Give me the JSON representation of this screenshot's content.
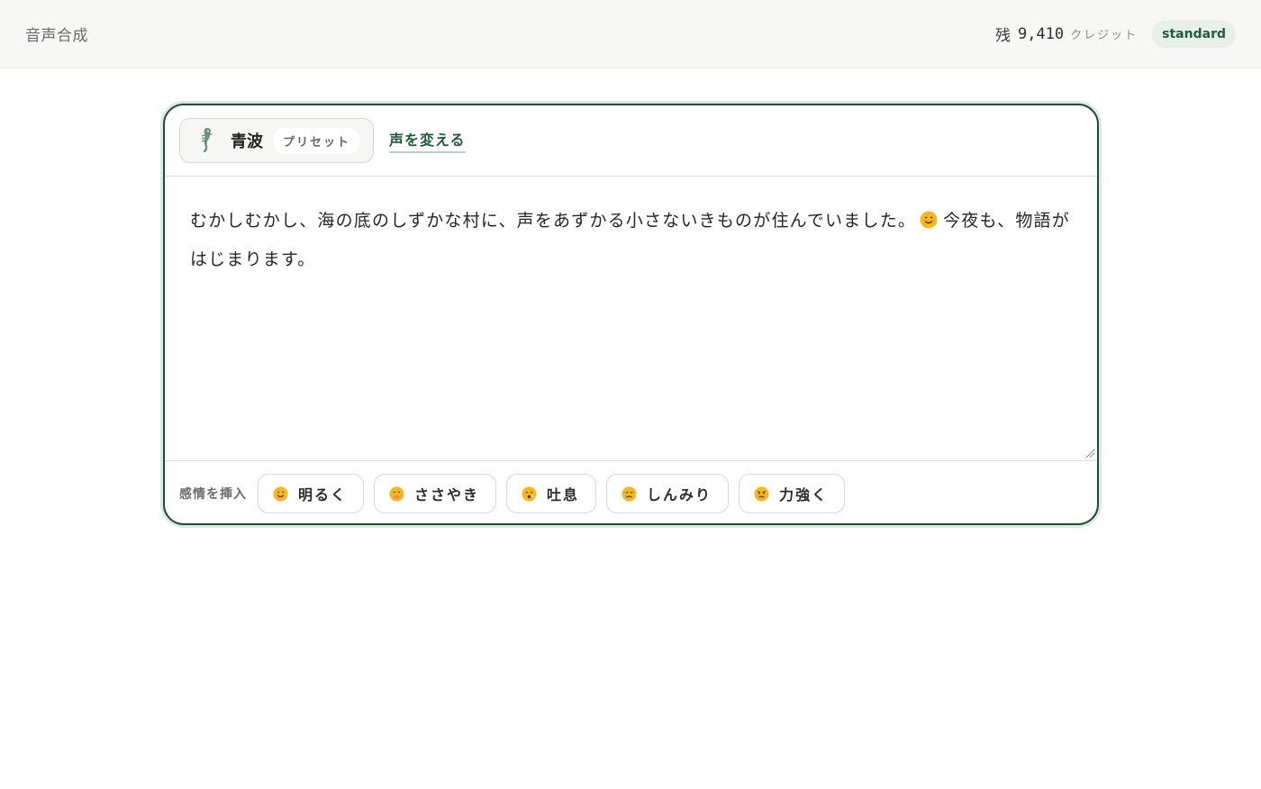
{
  "header": {
    "title": "音声合成",
    "credits_prefix": "残",
    "credits_value": "9,410",
    "credits_unit": "クレジット",
    "plan": "standard"
  },
  "voice": {
    "name": "青波",
    "tag": "プリセット",
    "change_label": "声を変える",
    "icon": "seahorse-icon"
  },
  "editor": {
    "text_before_emoji": "むかしむかし、海の底のしずかな村に、声をあずかる小さないきものが住んでいました。",
    "inline_emoji": "smiling-face-emoji",
    "text_after_emoji": "今夜も、物語がはじまります。"
  },
  "emotions": {
    "label": "感情を挿入",
    "items": [
      {
        "label": "明るく",
        "icon": "smiling-face-icon"
      },
      {
        "label": "ささやき",
        "icon": "hand-over-mouth-face-icon"
      },
      {
        "label": "吐息",
        "icon": "exhaling-face-icon"
      },
      {
        "label": "しんみり",
        "icon": "crying-face-icon"
      },
      {
        "label": "力強く",
        "icon": "angry-face-icon"
      }
    ]
  },
  "colors": {
    "accent": "#1f4d35",
    "badge_bg": "#e6efe8",
    "emoji_yellow": "#f5b820"
  }
}
